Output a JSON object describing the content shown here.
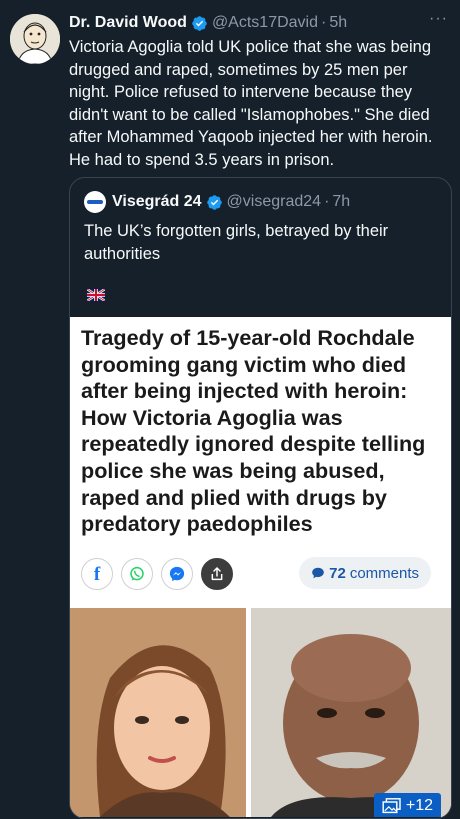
{
  "tweet": {
    "author_name": "Dr. David Wood",
    "handle": "@Acts17David",
    "separator": "·",
    "time": "5h",
    "more_label": "···",
    "text": "Victoria Agoglia told UK police that she was being drugged and raped, sometimes by 25 men per night. Police refused to intervene because they didn't want to be called \"Islamophobes.\" She died after Mohammed Yaqoob injected her with heroin. He had to spend 3.5 years in prison."
  },
  "quote": {
    "author_name": "Visegrád 24",
    "handle": "@visegrad24",
    "separator": "·",
    "time": "7h",
    "text": "The UK’s forgotten girls, betrayed by their authorities",
    "flag_icon": "uk-flag-icon"
  },
  "article": {
    "headline": "Tragedy of 15-year-old Rochdale grooming gang victim who died after being injected with heroin: How Victoria Agoglia was repeatedly ignored despite telling police she was being abused, raped and plied with drugs by predatory paedophiles",
    "comments_count": "72",
    "comments_label": "comments",
    "facebook_letter": "f",
    "more_images": "+12"
  },
  "colors": {
    "background": "#15202b",
    "verified_badge": "#1d9bf0",
    "muted_text": "#8b98a5",
    "border": "#38444d",
    "article_link": "#1b57a6"
  }
}
